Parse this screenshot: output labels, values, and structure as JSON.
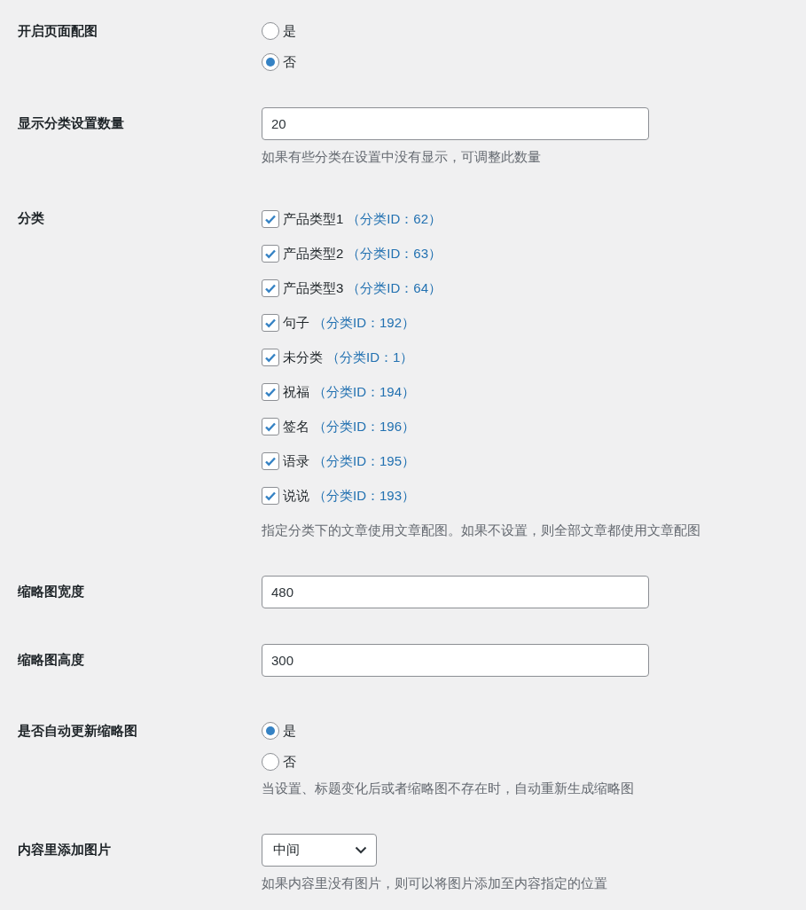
{
  "rows": [
    {
      "kind": "radio",
      "label": "开启页面配图",
      "options": [
        {
          "label": "是",
          "selected": false
        },
        {
          "label": "否",
          "selected": true
        }
      ]
    },
    {
      "kind": "text",
      "label": "显示分类设置数量",
      "value": "20",
      "description": "如果有些分类在设置中没有显示，可调整此数量"
    },
    {
      "kind": "checkboxes",
      "label": "分类",
      "options": [
        {
          "label": "产品类型1",
          "note": "（分类ID：62）",
          "checked": true
        },
        {
          "label": "产品类型2",
          "note": "（分类ID：63）",
          "checked": true
        },
        {
          "label": "产品类型3",
          "note": "（分类ID：64）",
          "checked": true
        },
        {
          "label": "句子",
          "note": "（分类ID：192）",
          "checked": true
        },
        {
          "label": "未分类",
          "note": "（分类ID：1）",
          "checked": true
        },
        {
          "label": "祝福",
          "note": "（分类ID：194）",
          "checked": true
        },
        {
          "label": "签名",
          "note": "（分类ID：196）",
          "checked": true
        },
        {
          "label": "语录",
          "note": "（分类ID：195）",
          "checked": true
        },
        {
          "label": "说说",
          "note": "（分类ID：193）",
          "checked": true
        }
      ],
      "description": "指定分类下的文章使用文章配图。如果不设置，则全部文章都使用文章配图"
    },
    {
      "kind": "text",
      "label": "缩略图宽度",
      "value": "480"
    },
    {
      "kind": "text",
      "label": "缩略图高度",
      "value": "300"
    },
    {
      "kind": "radio",
      "label": "是否自动更新缩略图",
      "options": [
        {
          "label": "是",
          "selected": true
        },
        {
          "label": "否",
          "selected": false
        }
      ],
      "description": "当设置、标题变化后或者缩略图不存在时，自动重新生成缩略图"
    },
    {
      "kind": "select",
      "label": "内容里添加图片",
      "value": "中间",
      "description": "如果内容里没有图片，则可以将图片添加至内容指定的位置"
    }
  ]
}
